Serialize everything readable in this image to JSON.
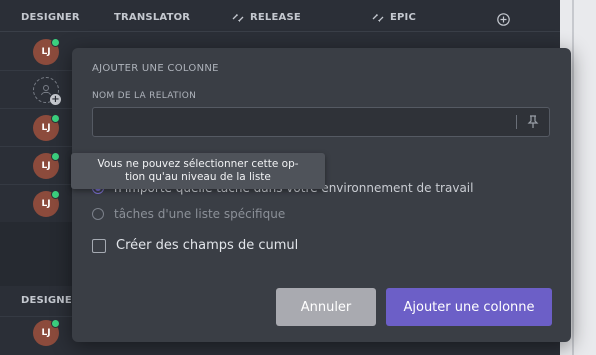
{
  "table": {
    "headers": {
      "designer": "DESIGNER",
      "translator": "TRANSLATOR",
      "release": "RELEASE",
      "epic": "EPIC",
      "designer_bottom": "DESIGNER"
    },
    "avatar_initials": "LJ"
  },
  "modal": {
    "title": "AJOUTER UNE COLONNE",
    "field_label": "NOM DE LA RELATION",
    "field_value": "",
    "option_any": "n'importe quelle tâche dans votre environnement de travail",
    "option_list": "tâches d'une liste spécifique",
    "checkbox_label": "Créer des champs de cumul",
    "cancel_label": "Annuler",
    "add_label": "Ajouter une colonne"
  },
  "tooltip": {
    "line1": "Vous ne pouvez sélectionner cette op-",
    "line2": "tion qu'au niveau de la liste"
  },
  "colors": {
    "accent": "#6c5fc7",
    "online": "#3bd17f",
    "avatar": "#8c4b3c"
  }
}
